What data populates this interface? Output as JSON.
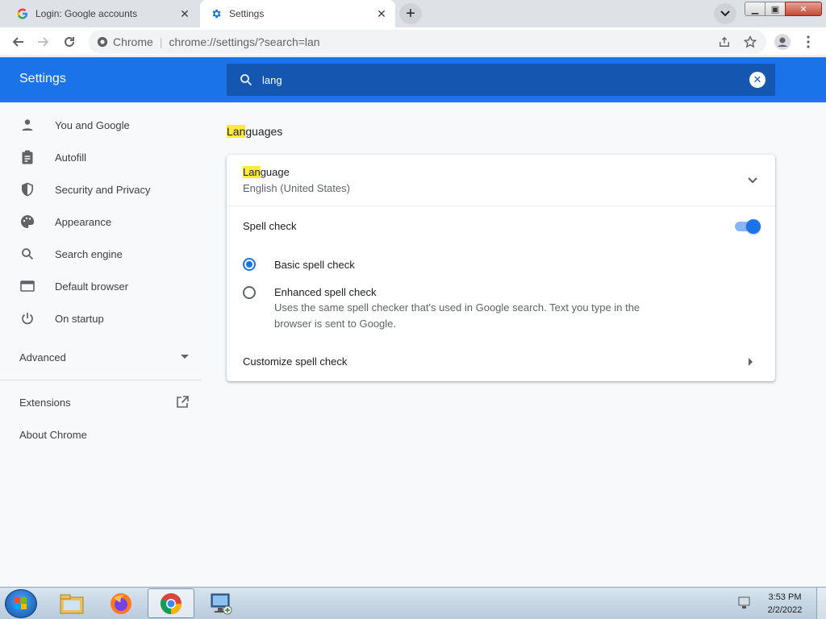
{
  "browser": {
    "tabs": [
      {
        "title": "Login: Google accounts",
        "favicon": "google-g-icon",
        "active": false
      },
      {
        "title": "Settings",
        "favicon": "settings-gear-icon",
        "active": true
      }
    ],
    "omnibox": {
      "site_label": "Chrome",
      "url": "chrome://settings/?search=lan"
    }
  },
  "settings": {
    "app_title": "Settings",
    "search": {
      "value": "lang",
      "placeholder": "Search settings"
    },
    "sidebar": {
      "items": [
        {
          "label": "You and Google",
          "icon": "person-icon"
        },
        {
          "label": "Autofill",
          "icon": "clipboard-icon"
        },
        {
          "label": "Security and Privacy",
          "icon": "shield-icon"
        },
        {
          "label": "Appearance",
          "icon": "palette-icon"
        },
        {
          "label": "Search engine",
          "icon": "search-icon"
        },
        {
          "label": "Default browser",
          "icon": "browser-window-icon"
        },
        {
          "label": "On startup",
          "icon": "power-icon"
        }
      ],
      "advanced_label": "Advanced",
      "extensions_label": "Extensions",
      "about_label": "About Chrome"
    },
    "section": {
      "title_highlight": "Lan",
      "title_rest": "guages",
      "language": {
        "label_highlight": "Lan",
        "label_rest": "guage",
        "value": "English (United States)"
      },
      "spell_check": {
        "label": "Spell check",
        "enabled": true
      },
      "options": [
        {
          "label": "Basic spell check",
          "checked": true
        },
        {
          "label": "Enhanced spell check",
          "checked": false,
          "description": "Uses the same spell checker that's used in Google search. Text you type in the browser is sent to Google."
        }
      ],
      "customize_label": "Customize spell check"
    }
  },
  "taskbar": {
    "time": "3:53 PM",
    "date": "2/2/2022",
    "apps": [
      "file-explorer-icon",
      "firefox-icon",
      "chrome-icon",
      "network-computer-icon"
    ]
  },
  "colors": {
    "accent": "#1a73e8",
    "header": "#1a73e8",
    "highlight": "#ffeb3b"
  }
}
